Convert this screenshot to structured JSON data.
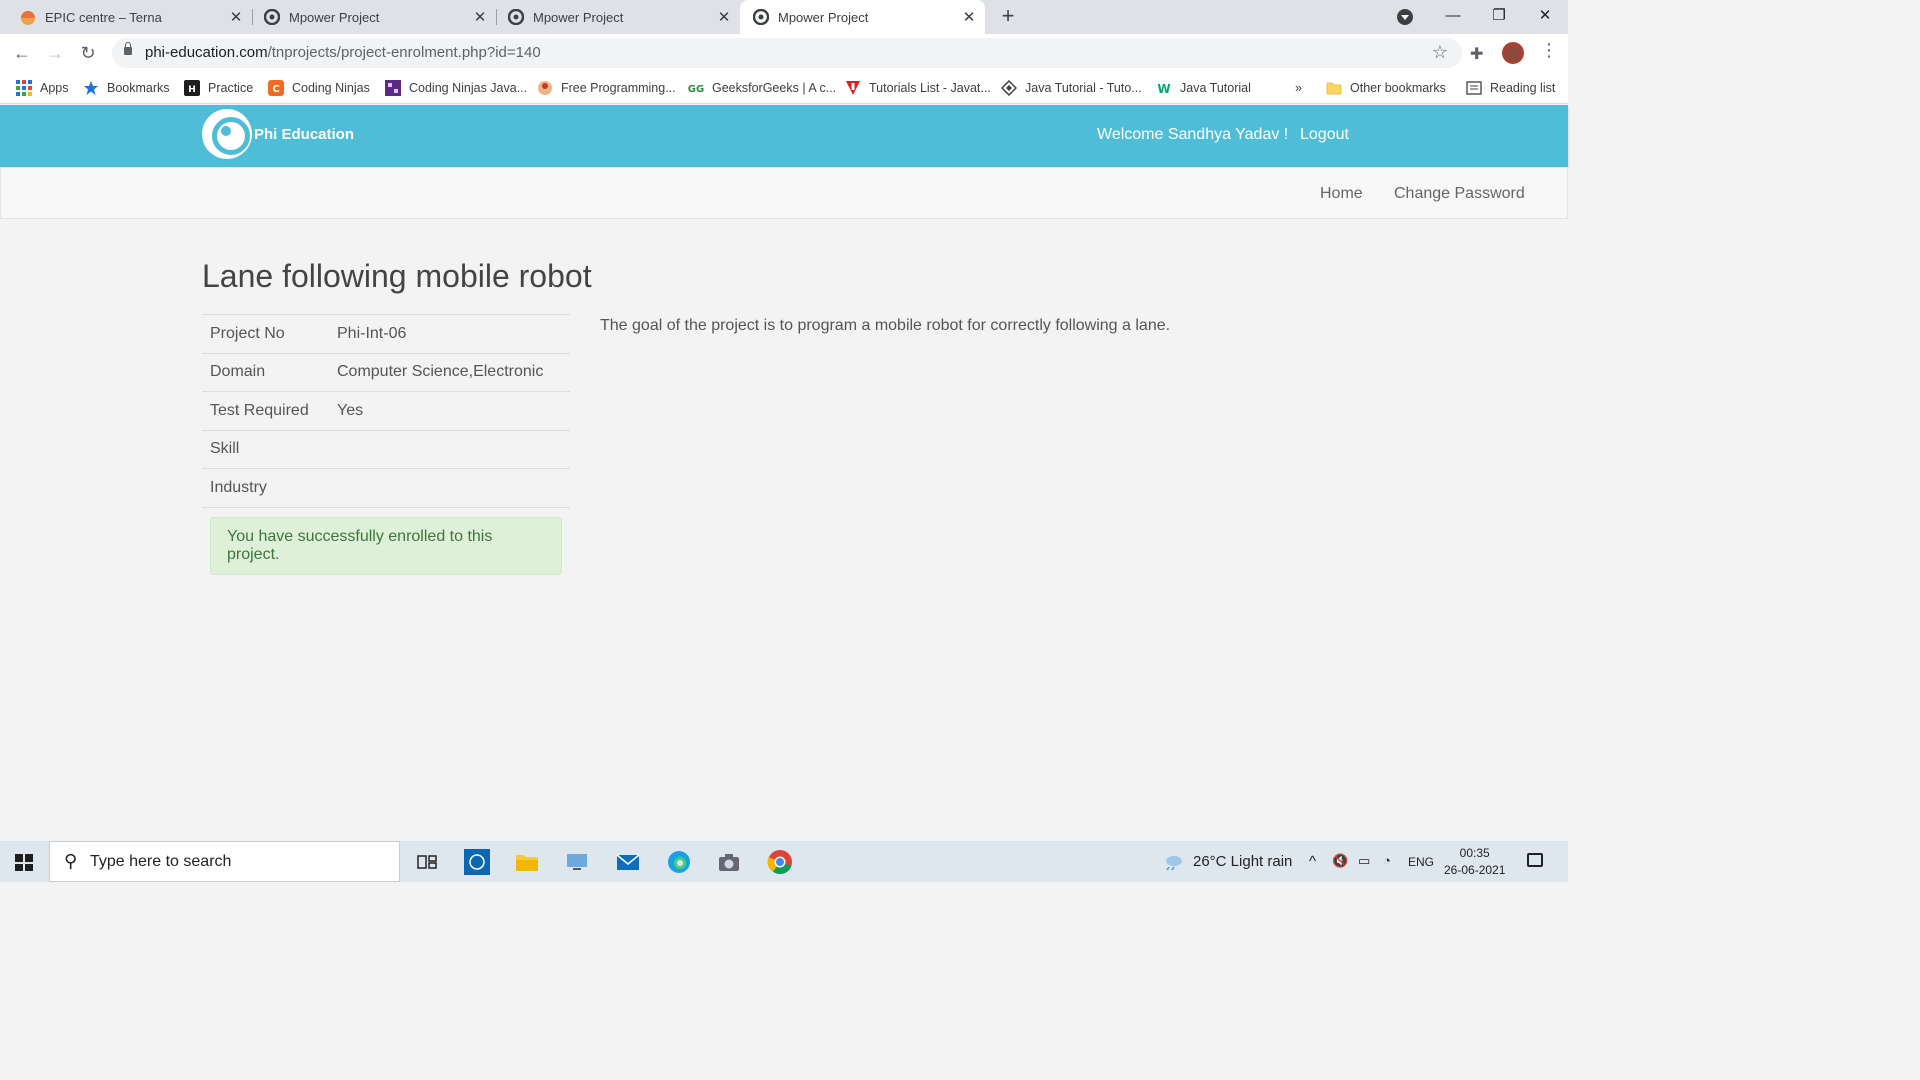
{
  "browser": {
    "tabs": [
      {
        "title": "EPIC centre – Terna",
        "active": false,
        "icon": "epic-favicon"
      },
      {
        "title": "Mpower Project",
        "active": false,
        "icon": "mpower-favicon"
      },
      {
        "title": "Mpower Project",
        "active": false,
        "icon": "mpower-favicon"
      },
      {
        "title": "Mpower Project",
        "active": true,
        "icon": "mpower-favicon"
      }
    ],
    "url_host": "phi-education.com",
    "url_path": "/tnprojects/project-enrolment.php?id=140",
    "bookmarks": [
      {
        "label": "Apps",
        "icon": "apps-grid-icon"
      },
      {
        "label": "Bookmarks",
        "icon": "star-icon"
      },
      {
        "label": "Practice",
        "icon": "hackerrank-icon"
      },
      {
        "label": "Coding Ninjas",
        "icon": "coding-ninjas-icon"
      },
      {
        "label": "Coding Ninjas Java...",
        "icon": "coding-ninjas-java-icon"
      },
      {
        "label": "Free Programming...",
        "icon": "free-programming-icon"
      },
      {
        "label": "GeeksforGeeks | A c...",
        "icon": "geeksforgeeks-icon"
      },
      {
        "label": "Tutorials List - Javat...",
        "icon": "javatpoint-icon"
      },
      {
        "label": "Java Tutorial - Tuto...",
        "icon": "tutorialspoint-icon"
      },
      {
        "label": "Java Tutorial",
        "icon": "w3schools-icon"
      }
    ],
    "overflow": "»",
    "other_bookmarks": "Other bookmarks",
    "reading_list": "Reading list"
  },
  "site": {
    "brand": "Phi Education",
    "welcome": "Welcome Sandhya Yadav !",
    "logout": "Logout",
    "nav": {
      "home": "Home",
      "change_password": "Change Password"
    }
  },
  "project": {
    "title": "Lane following mobile robot",
    "fields": [
      {
        "label": "Project No",
        "value": "Phi-Int-06"
      },
      {
        "label": "Domain",
        "value": "Computer Science,Electronic"
      },
      {
        "label": "Test Required",
        "value": "Yes"
      },
      {
        "label": "Skill",
        "value": ""
      },
      {
        "label": "Industry",
        "value": ""
      }
    ],
    "success_message": "You have successfully enrolled to this project.",
    "description": "The goal of the project is to program a mobile robot for correctly following a lane."
  },
  "taskbar": {
    "search_placeholder": "Type here to search",
    "weather": "26°C  Light rain",
    "language": "ENG",
    "time": "00:35",
    "date": "26-06-2021"
  },
  "colors": {
    "header": "#4fbcd8",
    "success_bg": "#dff0d8",
    "success_text": "#3c763d"
  }
}
